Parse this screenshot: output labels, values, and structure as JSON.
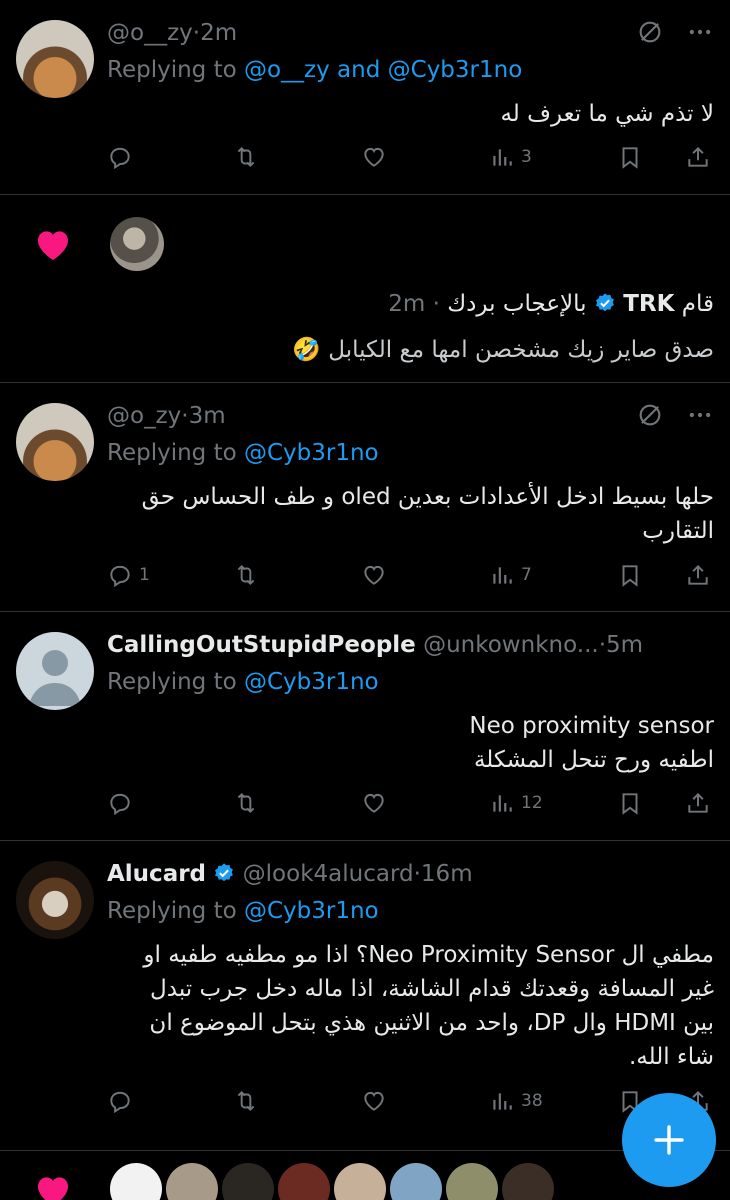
{
  "tweets": [
    {
      "handle": "@o__zy",
      "time": "2m",
      "replying_prefix": "Replying to ",
      "replying_to": "@o__zy and @Cyb3r1no",
      "body": [
        "لا تذم شي ما تعرف له"
      ],
      "views": "3",
      "replies": ""
    },
    {
      "handle": "@o_zy",
      "time": "3m",
      "replying_prefix": "Replying to ",
      "replying_to": "@Cyb3r1no",
      "body": [
        "حلها بسيط ادخل الأعدادات بعدين oled و طف الحساس حق",
        "التقارب"
      ],
      "replies": "1",
      "views": "7"
    },
    {
      "display_name": "CallingOutStupidPeople",
      "handle": "@unkownkno...",
      "time": "5m",
      "replying_prefix": "Replying to ",
      "replying_to": "@Cyb3r1no",
      "body": [
        "Neo proximity sensor",
        "اطفيه ورح تنحل المشكلة"
      ],
      "views": "12"
    },
    {
      "display_name": "Alucard",
      "handle": "@look4alucard",
      "time": "16m",
      "replying_prefix": "Replying to ",
      "replying_to": "@Cyb3r1no",
      "body": [
        "مطفي ال Neo Proximity Sensor؟ اذا مو مطفيه طفيه او",
        "غير المسافة وقعدتك قدام الشاشة، اذا ماله دخل جرب تبدل",
        "بين HDMI وال DP، واحد من الاثنين هذي بتحل الموضوع ان",
        "شاء الله."
      ],
      "views": "38"
    }
  ],
  "like_notice": {
    "prefix": "قام",
    "name": "TRK",
    "action": "بالإعجاب بردك",
    "time": "2m ·",
    "quote": "صدق صاير زيك مشخصن امها مع الكيابل 🤣"
  },
  "separator": "·",
  "colors": {
    "accent": "#1d9bf0",
    "like": "#f91880",
    "muted": "#71767b",
    "text": "#e7e9ea",
    "border": "#2f3336"
  },
  "icons": [
    "grok-icon",
    "more-icon",
    "reply-icon",
    "retweet-icon",
    "like-icon",
    "views-icon",
    "bookmark-icon",
    "share-icon",
    "verified-icon",
    "heart-filled-icon",
    "compose-plus-icon"
  ]
}
